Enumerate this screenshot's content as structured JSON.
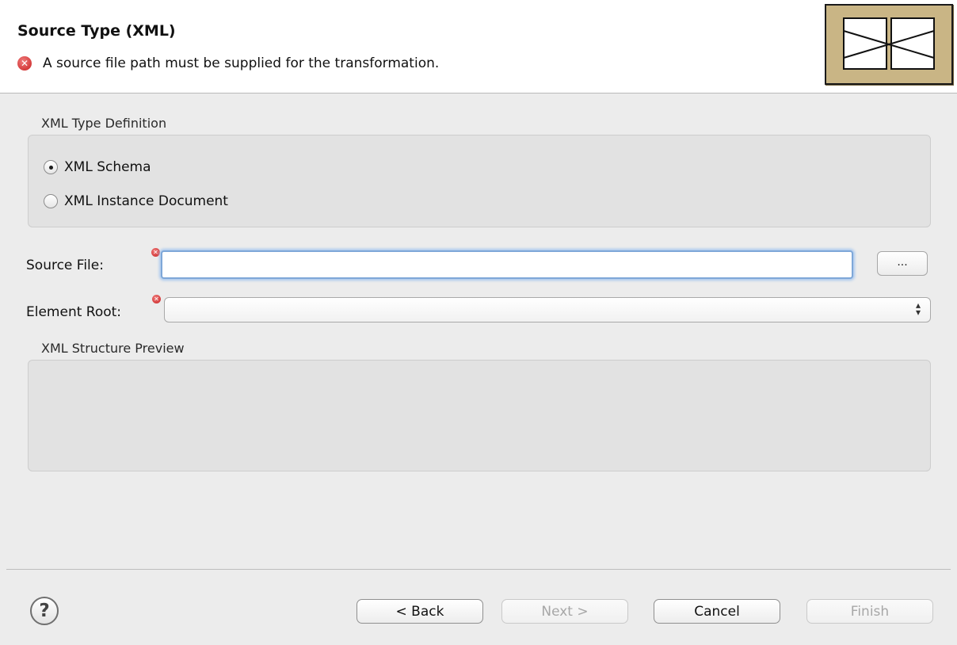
{
  "header": {
    "title": "Source Type (XML)",
    "message": "A source file path must be supplied for the transformation.",
    "error_icon": "error-icon",
    "image_icon": "wizard-banner-image"
  },
  "type_definition": {
    "group_label": "XML Type Definition",
    "options": [
      {
        "label": "XML Schema",
        "checked": true
      },
      {
        "label": "XML Instance Document",
        "checked": false
      }
    ]
  },
  "source_file": {
    "label": "Source File:",
    "value": "",
    "placeholder": "",
    "browse_label": "..."
  },
  "element_root": {
    "label": "Element Root:",
    "value": ""
  },
  "preview": {
    "group_label": "XML Structure Preview"
  },
  "footer": {
    "help_icon": "help-icon",
    "help_glyph": "?",
    "back_label": "< Back",
    "next_label": "Next >",
    "cancel_label": "Cancel",
    "finish_label": "Finish"
  },
  "colors": {
    "error": "#c82020",
    "focus_ring": "#7ea7d8",
    "banner": "#c9b585"
  }
}
